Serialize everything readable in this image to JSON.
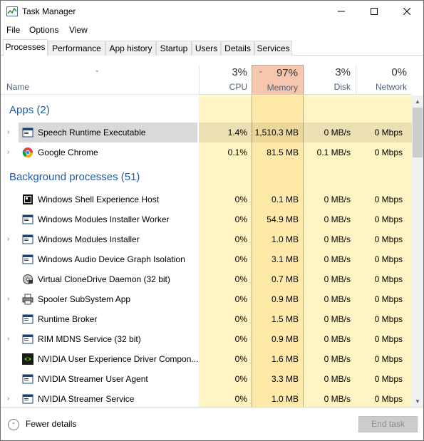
{
  "window": {
    "title": "Task Manager"
  },
  "menu": [
    "File",
    "Options",
    "View"
  ],
  "tabs": [
    "Processes",
    "Performance",
    "App history",
    "Startup",
    "Users",
    "Details",
    "Services"
  ],
  "header": {
    "name_label": "Name",
    "cpu": {
      "pct": "3%",
      "label": "CPU"
    },
    "memory": {
      "pct": "97%",
      "label": "Memory"
    },
    "disk": {
      "pct": "3%",
      "label": "Disk"
    },
    "network": {
      "pct": "0%",
      "label": "Network"
    }
  },
  "groups": {
    "apps": "Apps (2)",
    "background": "Background processes (51)"
  },
  "apps": [
    {
      "name": "Speech Runtime Executable",
      "cpu": "1.4%",
      "mem": "1,510.3 MB",
      "disk": "0 MB/s",
      "net": "0 Mbps",
      "icon": "window-icon"
    },
    {
      "name": "Google Chrome",
      "cpu": "0.1%",
      "mem": "81.5 MB",
      "disk": "0.1 MB/s",
      "net": "0 Mbps",
      "icon": "chrome-icon"
    }
  ],
  "background": [
    {
      "name": "Windows Shell Experience Host",
      "cpu": "0%",
      "mem": "0.1 MB",
      "disk": "0 MB/s",
      "net": "0 Mbps"
    },
    {
      "name": "Windows Modules Installer Worker",
      "cpu": "0%",
      "mem": "54.9 MB",
      "disk": "0 MB/s",
      "net": "0 Mbps"
    },
    {
      "name": "Windows Modules Installer",
      "cpu": "0%",
      "mem": "1.0 MB",
      "disk": "0 MB/s",
      "net": "0 Mbps"
    },
    {
      "name": "Windows Audio Device Graph Isolation",
      "cpu": "0%",
      "mem": "3.1 MB",
      "disk": "0 MB/s",
      "net": "0 Mbps"
    },
    {
      "name": "Virtual CloneDrive Daemon (32 bit)",
      "cpu": "0%",
      "mem": "0.7 MB",
      "disk": "0 MB/s",
      "net": "0 Mbps"
    },
    {
      "name": "Spooler SubSystem App",
      "cpu": "0%",
      "mem": "0.9 MB",
      "disk": "0 MB/s",
      "net": "0 Mbps"
    },
    {
      "name": "Runtime Broker",
      "cpu": "0%",
      "mem": "1.5 MB",
      "disk": "0 MB/s",
      "net": "0 Mbps"
    },
    {
      "name": "RIM MDNS Service (32 bit)",
      "cpu": "0%",
      "mem": "0.9 MB",
      "disk": "0 MB/s",
      "net": "0 Mbps"
    },
    {
      "name": "NVIDIA User Experience Driver Compon...",
      "cpu": "0%",
      "mem": "1.6 MB",
      "disk": "0 MB/s",
      "net": "0 Mbps"
    },
    {
      "name": "NVIDIA Streamer User Agent",
      "cpu": "0%",
      "mem": "3.3 MB",
      "disk": "0 MB/s",
      "net": "0 Mbps"
    },
    {
      "name": "NVIDIA Streamer Service",
      "cpu": "0%",
      "mem": "1.0 MB",
      "disk": "0 MB/s",
      "net": "0 Mbps"
    }
  ],
  "footer": {
    "fewer_details": "Fewer details",
    "end_task": "End task"
  }
}
